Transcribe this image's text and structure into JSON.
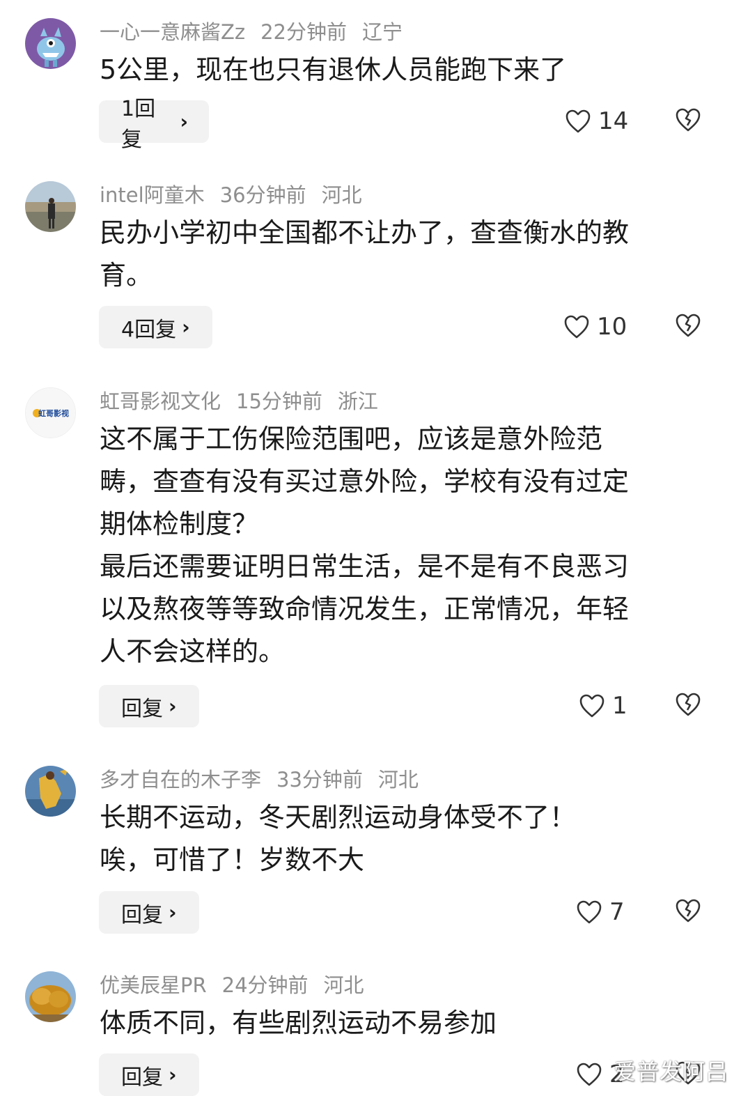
{
  "comments": [
    {
      "username": "一心一意麻酱Zz",
      "time": "22分钟前",
      "location": "辽宁",
      "text": "5公里，现在也只有退休人员能跑下来了",
      "reply_label": "1回复",
      "likes": "14",
      "avatar_icon": "blue-monster-avatar-icon"
    },
    {
      "username": "intel阿童木",
      "time": "36分钟前",
      "location": "河北",
      "text": "民办小学初中全国都不让办了，查查衡水的教\n育。",
      "reply_label": "4回复",
      "likes": "10",
      "avatar_icon": "man-by-river-photo-avatar-icon"
    },
    {
      "username": "虹哥影视文化",
      "time": "15分钟前",
      "location": "浙江",
      "text": "这不属于工伤保险范围吧，应该是意外险范\n畴，查查有没有买过意外险，学校有没有过定\n期体检制度？\n最后还需要证明日常生活，是不是有不良恶习\n以及熬夜等等致命情况发生，正常情况，年轻\n人不会这样的。",
      "reply_label": "回复",
      "likes": "1",
      "avatar_icon": "logo-avatar-icon",
      "avatar_logo_text": "虹哥影视"
    },
    {
      "username": "多才自在的木子李",
      "time": "33分钟前",
      "location": "河北",
      "text": "长期不运动，冬天剧烈运动身体受不了！\n唉，可惜了！岁数不大",
      "reply_label": "回复",
      "likes": "7",
      "avatar_icon": "basketball-player-avatar-icon"
    },
    {
      "username": "优美辰星PR",
      "time": "24分钟前",
      "location": "河北",
      "text": "体质不同，有些剧烈运动不易参加",
      "reply_label": "回复",
      "likes": "2",
      "avatar_icon": "golden-tree-avatar-icon"
    }
  ],
  "watermark": "爱普发阿吕",
  "colors": {
    "meta_gray": "#8e8e8e",
    "reply_bg": "#f2f2f2",
    "text": "#1a1a1a",
    "icon_stroke": "#333333"
  }
}
